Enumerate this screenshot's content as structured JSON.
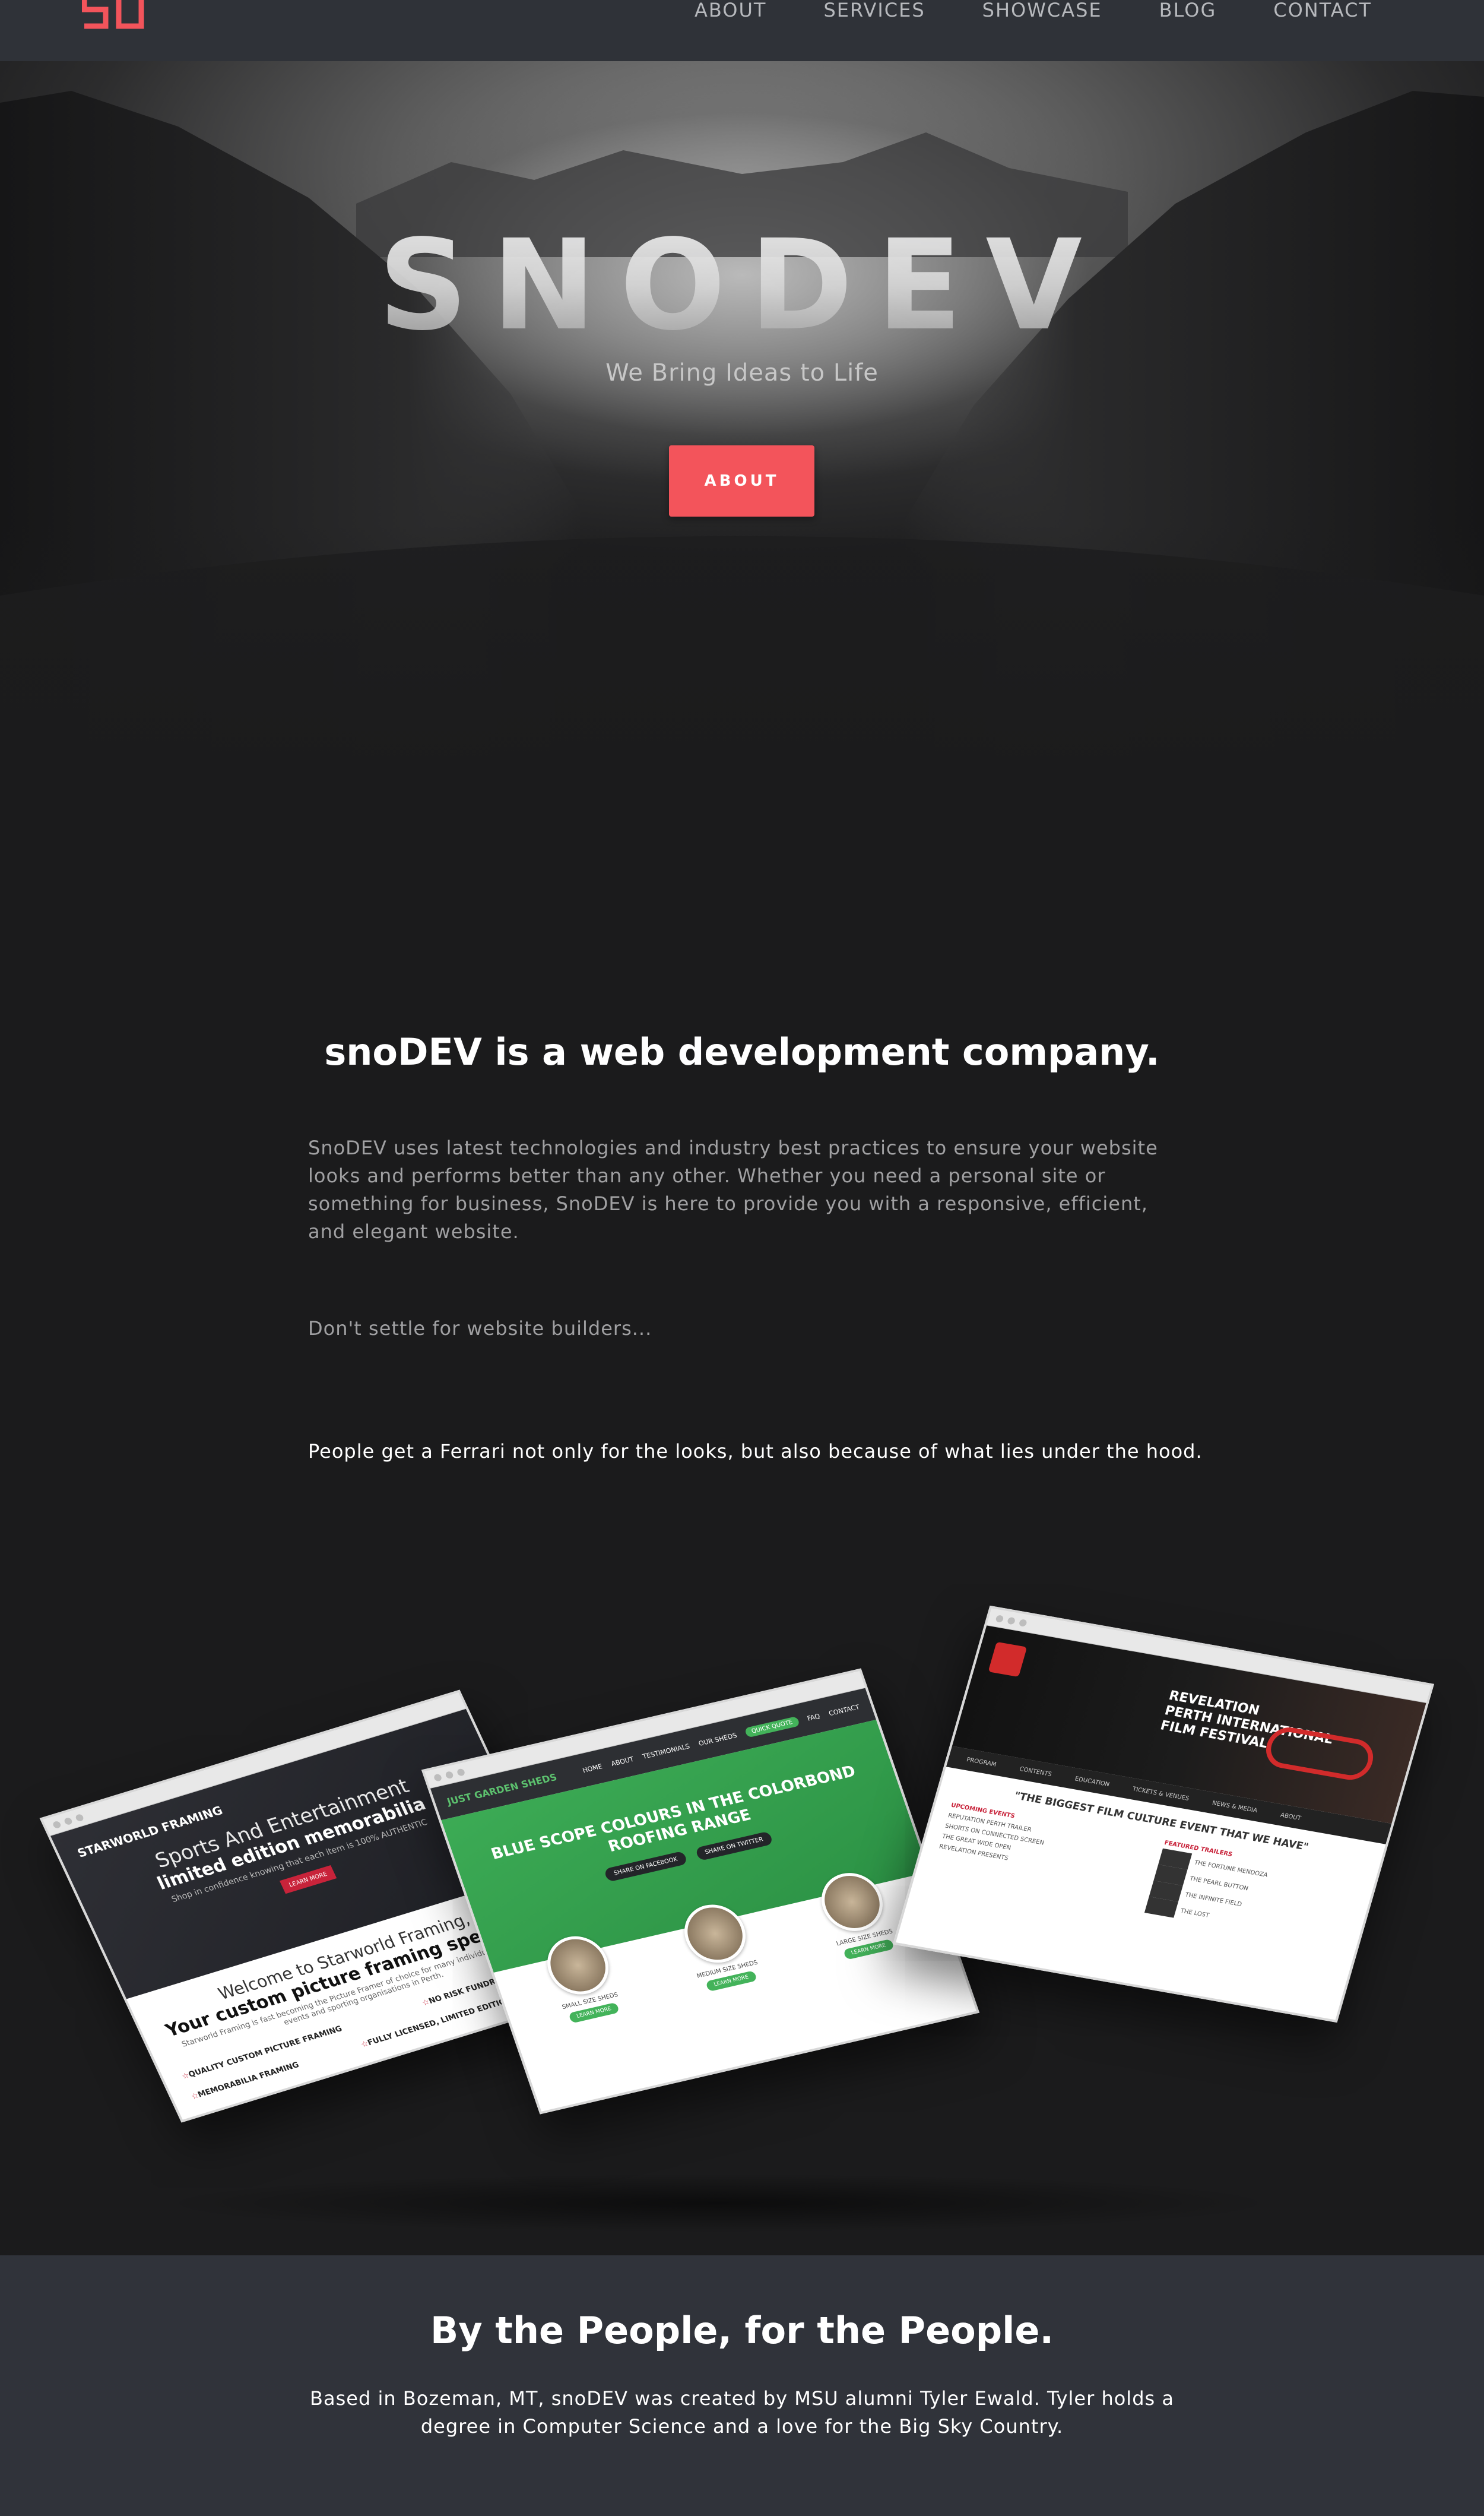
{
  "nav": {
    "logo_text": "SD",
    "links": [
      "ABOUT",
      "SERVICES",
      "SHOWCASE",
      "BLOG",
      "CONTACT"
    ]
  },
  "hero": {
    "title": "SNODEV",
    "subtitle": "We Bring Ideas to Life",
    "button": "ABOUT"
  },
  "about": {
    "heading": "snoDEV is a web development company.",
    "paragraph": "SnoDEV uses latest technologies and industry best practices to ensure your website looks and performs better than any other. Whether you need a personal site or something for business, SnoDEV is here to provide you with a responsive, efficient, and elegant website.",
    "line2": "Don't settle for website builders...",
    "line3": "People get a Ferrari not only for the looks, but also because of what lies under the hood."
  },
  "showcase": {
    "starworld": {
      "brand": "STARWORLD FRAMING",
      "headline1": "Sports And Entertainment",
      "headline2": "limited edition memorabilia",
      "sub": "Shop in confidence knowing that each item is 100% AUTHENTIC",
      "button": "LEARN MORE",
      "welcome1": "Welcome to Starworld Framing,",
      "welcome2": "Your custom picture framing specialist",
      "welcome3": "Starworld Framing is fast becoming the Picture Framer of choice for many individuals, corporate events and sporting organisations in Perth.",
      "features": [
        "QUALITY CUSTOM PICTURE FRAMING",
        "NO RISK FUNDRAISING OPTIONS",
        "MEMORABILIA FRAMING",
        "FULLY LICENSED, LIMITED EDITION MEMORABILIA"
      ]
    },
    "garden": {
      "logo": "JUST GARDEN SHEDS",
      "nav": [
        "HOME",
        "ABOUT",
        "TESTIMONIALS",
        "OUR SHEDS",
        "FAQ",
        "CONTACT"
      ],
      "pill": "QUICK QUOTE",
      "headline": "BLUE SCOPE COLOURS IN THE COLORBOND ROOFING RANGE",
      "buttons": [
        "SHARE ON FACEBOOK",
        "SHARE ON TWITTER"
      ],
      "items": [
        {
          "name": "SMALL SIZE SHEDS",
          "button": "LEARN MORE"
        },
        {
          "name": "MEDIUM SIZE SHEDS",
          "button": "LEARN MORE"
        },
        {
          "name": "LARGE SIZE SHEDS",
          "button": "LEARN MORE"
        }
      ]
    },
    "film": {
      "title_line1": "REVELATION",
      "title_line2": "PERTH INTERNATIONAL",
      "title_line3": "FILM FESTIVAL",
      "tabs": [
        "PROGRAM",
        "CONTENTS",
        "EDUCATION",
        "TICKETS & VENUES",
        "NEWS & MEDIA",
        "ABOUT"
      ],
      "heading": "\"THE BIGGEST FILM CULTURE EVENT THAT WE HAVE\"",
      "col1_title": "UPCOMING EVENTS",
      "col1": [
        "REPUTATION PERTH TRAILER",
        "SHORTS ON CONNECTED SCREEN",
        "THE GREAT WIDE OPEN",
        "REVELATION PRESENTS"
      ],
      "col2_title": "FEATURED TRAILERS",
      "col2": [
        "THE FORTUNE MENDOZA",
        "THE PEARL BUTTON",
        "THE INFINITE FIELD",
        "THE LOST"
      ]
    }
  },
  "people": {
    "heading": "By the People, for the People.",
    "paragraph": "Based in Bozeman, MT, snoDEV was created by MSU alumni Tyler Ewald. Tyler holds a degree in Computer Science and a love for the Big Sky Country."
  },
  "colors": {
    "accent": "#f3545b",
    "nav_bg": "#2f3238",
    "page_bg": "#1b1b1c",
    "footer_bg": "#30333a"
  }
}
